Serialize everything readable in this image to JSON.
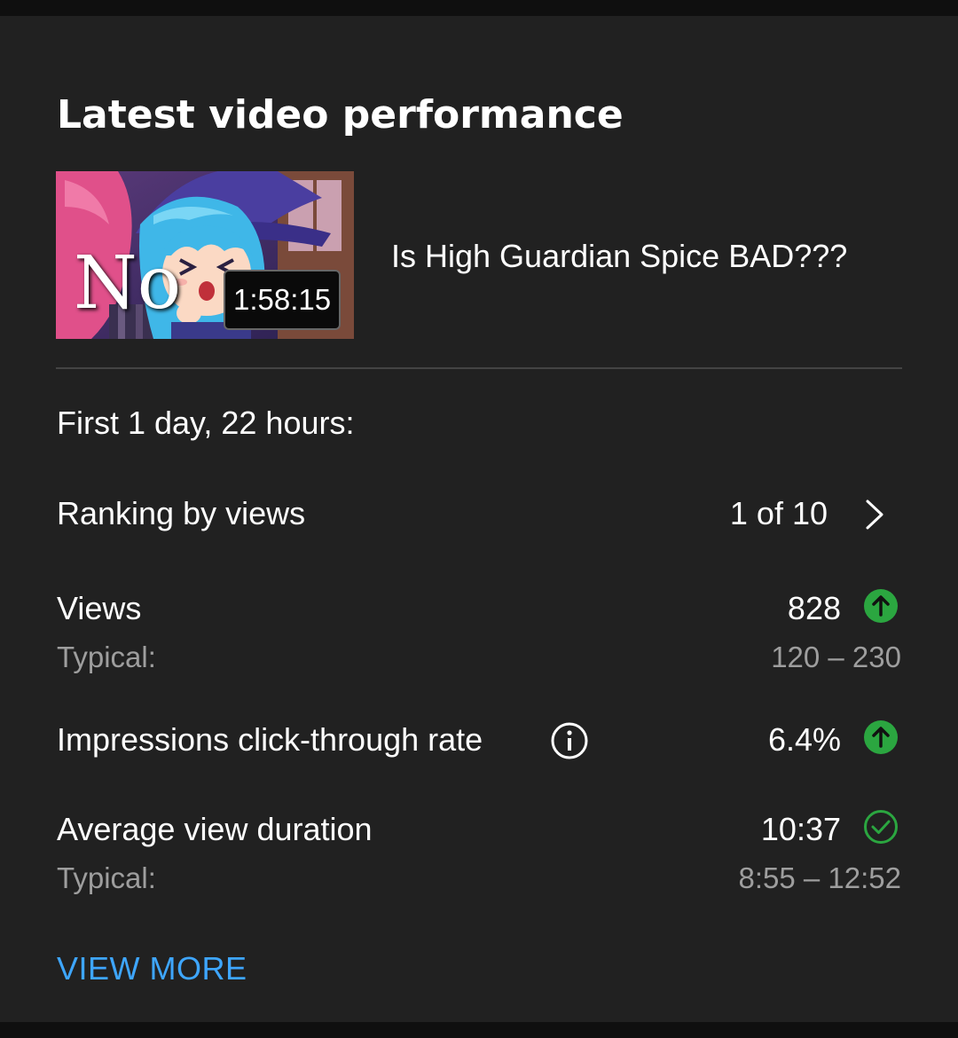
{
  "card": {
    "title": "Latest video performance"
  },
  "video": {
    "title": "Is High Guardian Spice BAD???",
    "duration": "1:58:15",
    "thumbnail_overlay_text": "No"
  },
  "period": "First 1 day, 22 hours:",
  "ranking": {
    "label": "Ranking by views",
    "value": "1 of 10",
    "icon": "chevron-right-icon"
  },
  "metrics": [
    {
      "label": "Views",
      "value": "828",
      "typical_label": "Typical:",
      "typical_value": "120 – 230",
      "status_icon": "arrow-up-circle-icon",
      "status_color": "#2ba640"
    },
    {
      "label": "Impressions click-through rate",
      "value": "6.4%",
      "status_icon": "arrow-up-circle-icon",
      "status_color": "#2ba640",
      "info_icon": "info-icon"
    },
    {
      "label": "Average view duration",
      "value": "10:37",
      "typical_label": "Typical:",
      "typical_value": "8:55 – 12:52",
      "status_icon": "check-circle-outline-icon",
      "status_color": "#2ba640"
    }
  ],
  "view_more": "VIEW MORE",
  "colors": {
    "background": "#212121",
    "text_primary": "#ffffff",
    "text_secondary": "#9e9e9e",
    "accent": "#3ea6ff",
    "positive": "#2ba640"
  }
}
